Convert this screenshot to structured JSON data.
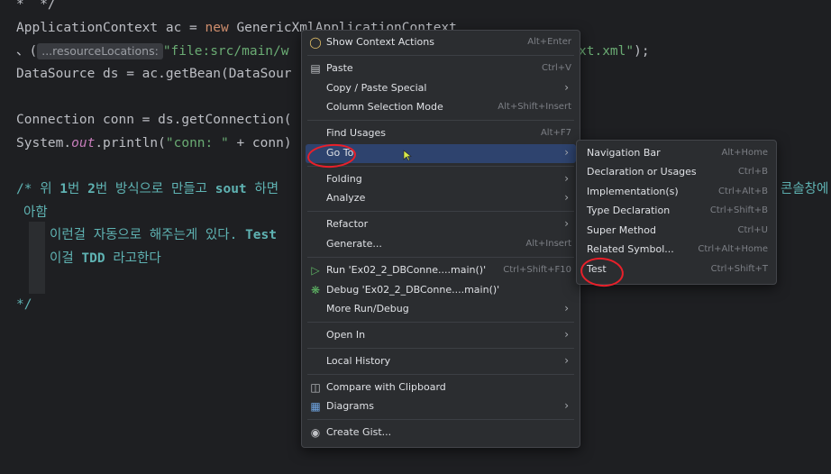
{
  "editor": {
    "line1": "*  */",
    "line2_a": "ApplicationContext ac = ",
    "line2_kw": "new",
    "line2_b": " GenericXmlApplicationContext",
    "line3_a": "、(",
    "line3_hint": "...resourceLocations:",
    "line3_str1": "\"file:src/main/w",
    "line3_str2": "xt.xml\"",
    "line3_end": ");",
    "line4": "DataSource ds = ac.getBean(DataSour",
    "line5": "Connection conn = ds.getConnection(",
    "line6_a": "System.",
    "line6_out": "out",
    "line6_b": ".println(",
    "line6_str": "\"conn: \"",
    "line6_c": " + conn)",
    "c1_a": "/* 위 ",
    "c1_b1": "1",
    "c1_b": "번 ",
    "c1_b2": "2",
    "c1_c": "번 방식으로 만들고 ",
    "c1_sout": "sout",
    "c1_d": " 하면",
    "c1_right": "콘솔창에",
    "c2": "아함",
    "c3_a": "이런걸 자동으로 해주는게 있다. ",
    "c3_test": "Test",
    "c4_a": "이걸 ",
    "c4_tdd": "TDD",
    "c4_b": " 라고한다",
    "close": "*/"
  },
  "context_menu": {
    "items": [
      {
        "label": "Show Context Actions",
        "shortcut": "Alt+Enter",
        "icon": "bulb-icon"
      },
      {
        "label": "Paste",
        "shortcut": "Ctrl+V",
        "icon": "clipboard-icon"
      },
      {
        "label": "Copy / Paste Special",
        "shortcut": ""
      },
      {
        "label": "Column Selection Mode",
        "shortcut": "Alt+Shift+Insert"
      },
      {
        "label": "Find Usages",
        "shortcut": "Alt+F7"
      },
      {
        "label": "Go To",
        "shortcut": ""
      },
      {
        "label": "Folding",
        "shortcut": ""
      },
      {
        "label": "Analyze",
        "shortcut": ""
      },
      {
        "label": "Refactor",
        "shortcut": ""
      },
      {
        "label": "Generate...",
        "shortcut": "Alt+Insert"
      },
      {
        "label": "Run 'Ex02_2_DBConne....main()'",
        "shortcut": "Ctrl+Shift+F10",
        "icon": "run-icon"
      },
      {
        "label": "Debug 'Ex02_2_DBConne....main()'",
        "shortcut": "",
        "icon": "debug-icon"
      },
      {
        "label": "More Run/Debug",
        "shortcut": ""
      },
      {
        "label": "Open In",
        "shortcut": ""
      },
      {
        "label": "Local History",
        "shortcut": ""
      },
      {
        "label": "Compare with Clipboard",
        "shortcut": "",
        "icon": "compare-icon"
      },
      {
        "label": "Diagrams",
        "shortcut": "",
        "icon": "diagram-icon"
      },
      {
        "label": "Create Gist...",
        "shortcut": "",
        "icon": "github-icon"
      }
    ]
  },
  "goto_submenu": {
    "items": [
      {
        "label": "Navigation Bar",
        "shortcut": "Alt+Home"
      },
      {
        "label": "Declaration or Usages",
        "shortcut": "Ctrl+B"
      },
      {
        "label": "Implementation(s)",
        "shortcut": "Ctrl+Alt+B"
      },
      {
        "label": "Type Declaration",
        "shortcut": "Ctrl+Shift+B"
      },
      {
        "label": "Super Method",
        "shortcut": "Ctrl+U"
      },
      {
        "label": "Related Symbol...",
        "shortcut": "Ctrl+Alt+Home"
      },
      {
        "label": "Test",
        "shortcut": "Ctrl+Shift+T"
      }
    ]
  },
  "colors": {
    "background": "#1e1f22",
    "menu_bg": "#2b2d30",
    "selection": "#2e436e",
    "annotation": "#e8202a"
  }
}
